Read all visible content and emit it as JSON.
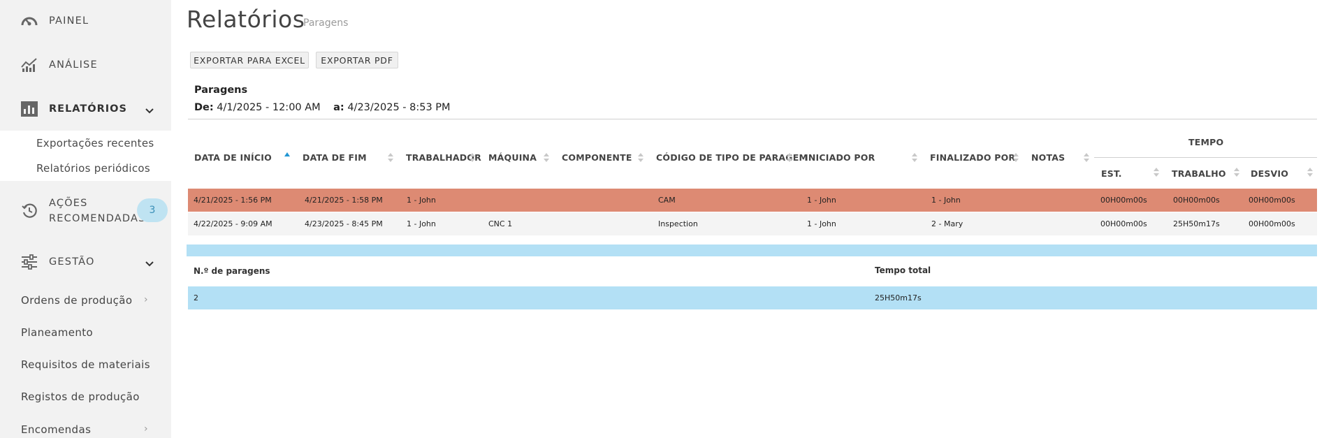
{
  "sidebar": {
    "nav": [
      {
        "label": "PAINEL",
        "icon": "gauge-icon"
      },
      {
        "label": "ANÁLISE",
        "icon": "chart-line-icon"
      },
      {
        "label": "RELATÓRIOS",
        "icon": "bar-chart-icon"
      },
      {
        "label": "AÇÕES RECOMENDADAS",
        "line1": "AÇÕES",
        "line2": "RECOMENDADAS",
        "icon": "history-icon",
        "badge": "3"
      },
      {
        "label": "GESTÃO",
        "icon": "sliders-icon"
      }
    ],
    "reports_sub": [
      "Exportações recentes",
      "Relatórios periódicos"
    ],
    "management_sub": [
      "Ordens de produção",
      "Planeamento",
      "Requisitos de materiais",
      "Registos de produção",
      "Encomendas"
    ]
  },
  "page": {
    "title": "Relatórios",
    "subtitle": "Paragens",
    "export_excel": "EXPORTAR PARA EXCEL",
    "export_pdf": "EXPORTAR PDF",
    "report_title": "Paragens",
    "from_label": "De:",
    "from_value": "4/1/2025 - 12:00 AM",
    "to_label": "a:",
    "to_value": "4/23/2025 - 8:53 PM"
  },
  "table": {
    "headers": {
      "start": "DATA DE INÍCIO",
      "end": "DATA DE FIM",
      "worker": "TRABALHADOR",
      "machine": "MÁQUINA",
      "component": "COMPONENTE",
      "code": "CÓDIGO DE TIPO DE PARAGEM",
      "started_by": "INICIADO POR",
      "finished_by": "FINALIZADO POR",
      "notes": "NOTAS",
      "time": "TEMPO",
      "est": "EST.",
      "work": "TRABALHO",
      "dev": "DESVIO"
    },
    "rows": [
      {
        "start": "4/21/2025 - 1:56 PM",
        "end": "4/21/2025 - 1:58 PM",
        "worker": "1 - John",
        "machine": "",
        "component": "",
        "code": "CAM",
        "started_by": "1 - John",
        "finished_by": "1 - John",
        "notes": "",
        "est": "00H00m00s",
        "work": "00H00m00s",
        "dev": "00H00m00s",
        "bg": "#dd8a73"
      },
      {
        "start": "4/22/2025 - 9:09 AM",
        "end": "4/23/2025 - 8:45 PM",
        "worker": "1 - John",
        "machine": "CNC 1",
        "component": "",
        "code": "Inspection",
        "started_by": "1 - John",
        "finished_by": "2 - Mary",
        "notes": "",
        "est": "00H00m00s",
        "work": "25H50m17s",
        "dev": "00H00m00s",
        "bg": "#f4f4f4"
      }
    ]
  },
  "summary": {
    "count_label": "N.º de paragens",
    "total_label": "Tempo total",
    "count_value": "2",
    "total_value": "25H50m17s"
  },
  "colors": {
    "accent": "#2196d3",
    "row_highlight": "#dd8a73",
    "summary_bg": "#b3e0f5",
    "badge_bg": "#bfe3f2"
  }
}
